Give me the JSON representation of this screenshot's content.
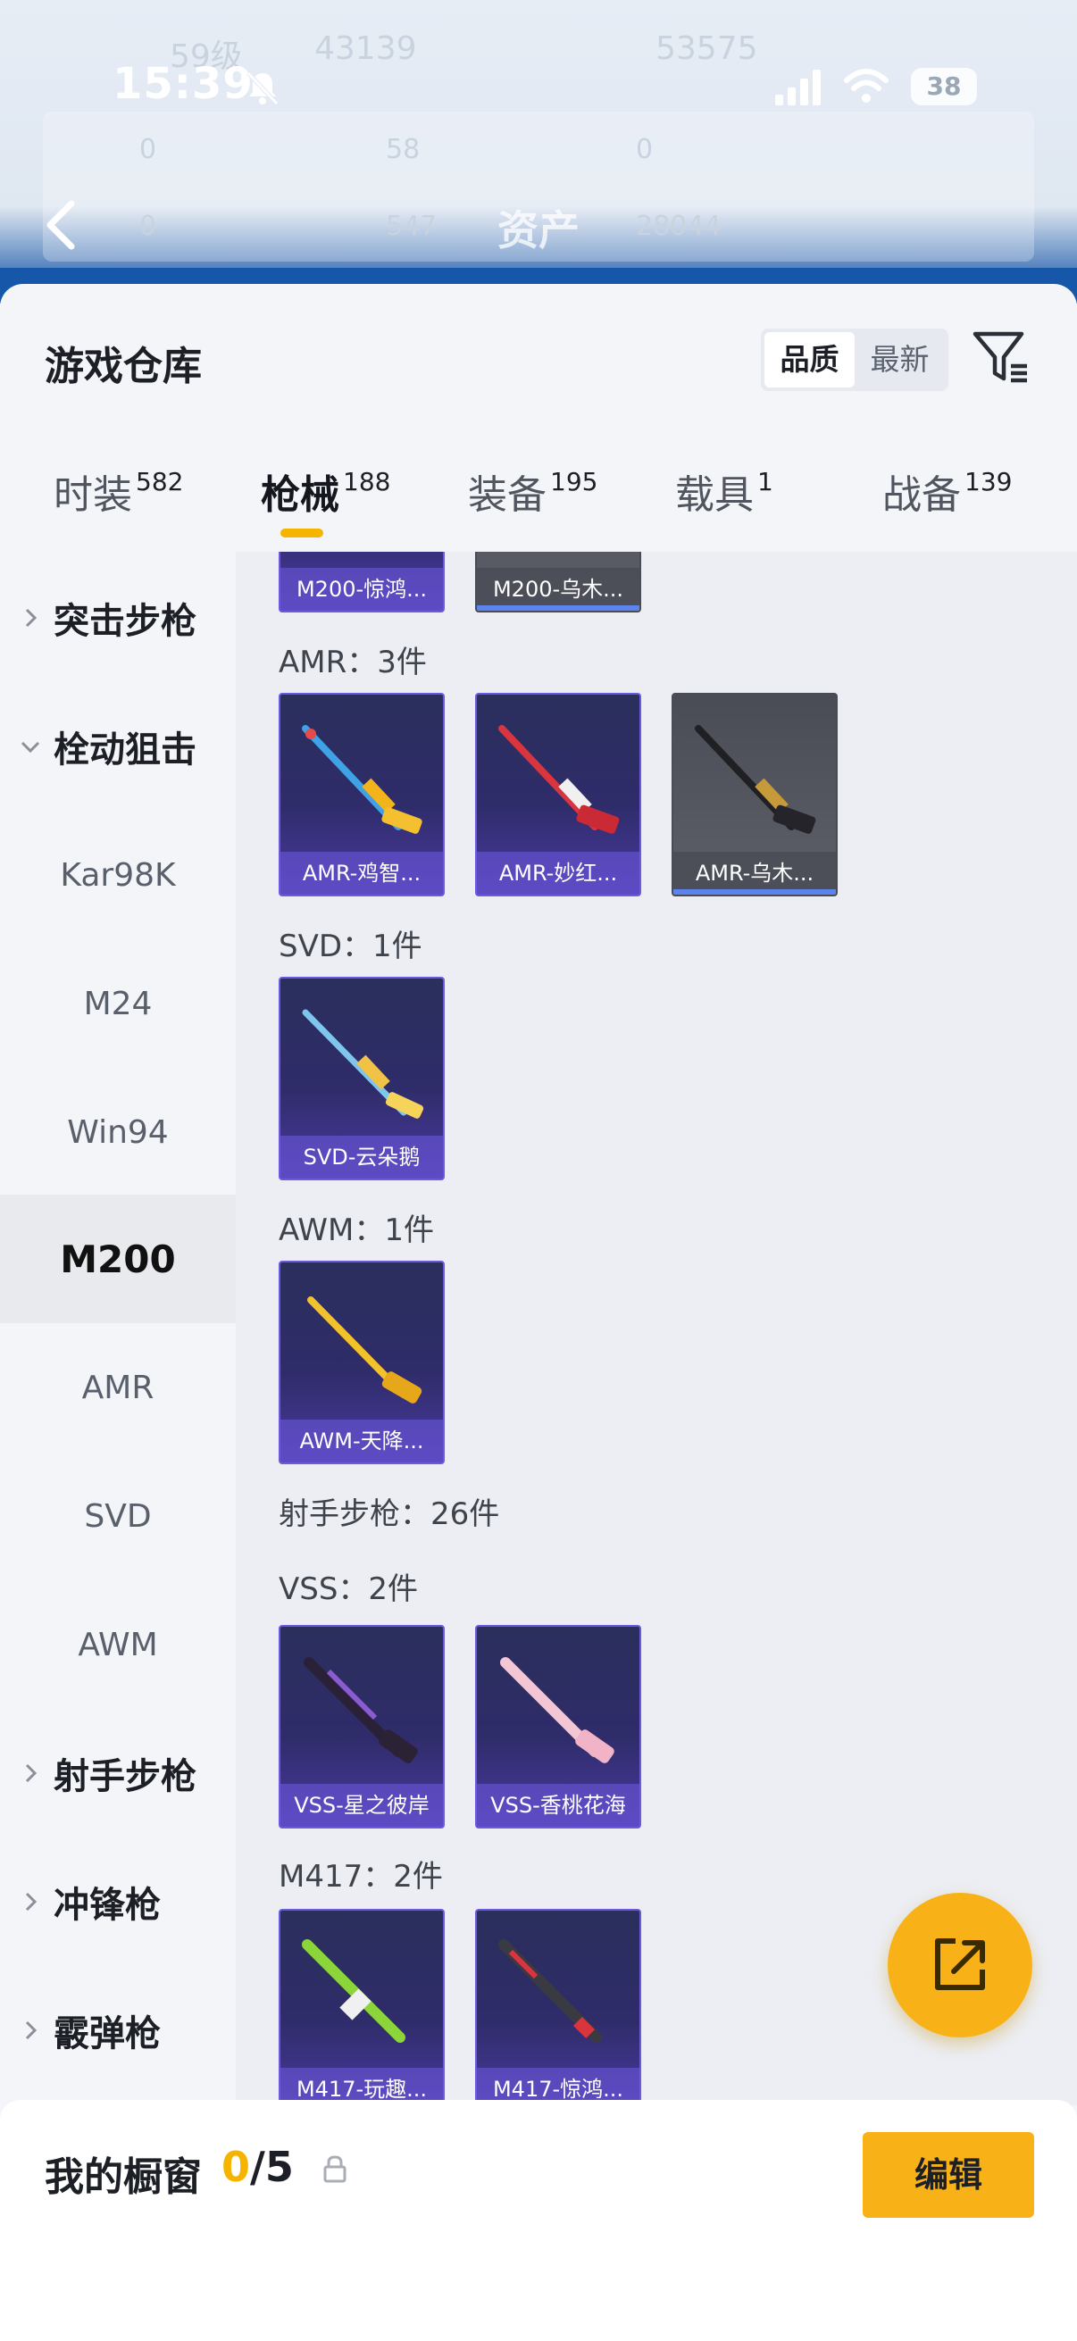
{
  "status_bar": {
    "time": "15:39",
    "battery": "38"
  },
  "header": {
    "title": "资产",
    "ghost": {
      "level": "59级",
      "coins": "43139",
      "score": "53575",
      "stat_1": "0",
      "stat_2": "58",
      "stat_3": "0",
      "stat_4": "0",
      "stat_5": "547",
      "stat_6": "28044"
    }
  },
  "sheet": {
    "title": "游戏仓库",
    "sort_options": [
      "品质",
      "最新"
    ],
    "tabs": [
      {
        "label": "时装",
        "count": "582"
      },
      {
        "label": "枪械",
        "count": "188"
      },
      {
        "label": "装备",
        "count": "195"
      },
      {
        "label": "载具",
        "count": "1"
      },
      {
        "label": "战备",
        "count": "139"
      }
    ]
  },
  "sidebar": {
    "items": [
      {
        "label": "突击步枪",
        "type": "category",
        "state": "collapsed"
      },
      {
        "label": "栓动狙击",
        "type": "category",
        "state": "expanded"
      },
      {
        "label": "Kar98K",
        "type": "sub"
      },
      {
        "label": "M24",
        "type": "sub"
      },
      {
        "label": "Win94",
        "type": "sub"
      },
      {
        "label": "M200",
        "type": "sub",
        "selected": true
      },
      {
        "label": "AMR",
        "type": "sub"
      },
      {
        "label": "SVD",
        "type": "sub"
      },
      {
        "label": "AWM",
        "type": "sub"
      },
      {
        "label": "射手步枪",
        "type": "category",
        "state": "collapsed"
      },
      {
        "label": "冲锋枪",
        "type": "category",
        "state": "collapsed"
      },
      {
        "label": "霰弹枪",
        "type": "category",
        "state": "collapsed"
      }
    ]
  },
  "content": {
    "m200_cards": [
      "M200-惊鸿...",
      "M200-乌木..."
    ],
    "groups": [
      {
        "title": "AMR：3件",
        "cards": [
          "AMR-鸡智...",
          "AMR-妙红...",
          "AMR-乌木..."
        ]
      },
      {
        "title": "SVD：1件",
        "cards": [
          "SVD-云朵鹅"
        ]
      },
      {
        "title": "AWM：1件",
        "cards": [
          "AWM-天降..."
        ]
      },
      {
        "title": "射手步枪：26件"
      },
      {
        "title": "VSS：2件",
        "cards": [
          "VSS-星之彼岸",
          "VSS-香桃花海"
        ]
      },
      {
        "title": "M417：2件",
        "cards": [
          "M417-玩趣...",
          "M417-惊鸿..."
        ]
      }
    ]
  },
  "bottom": {
    "label": "我的橱窗",
    "used": "0",
    "total": "/5",
    "edit_label": "编辑"
  },
  "colors": {
    "accent": "#f5b400",
    "card_purple": "#4a3aa0",
    "card_border": "#6b5ae0",
    "highlight_blue": "#5d84ee"
  }
}
